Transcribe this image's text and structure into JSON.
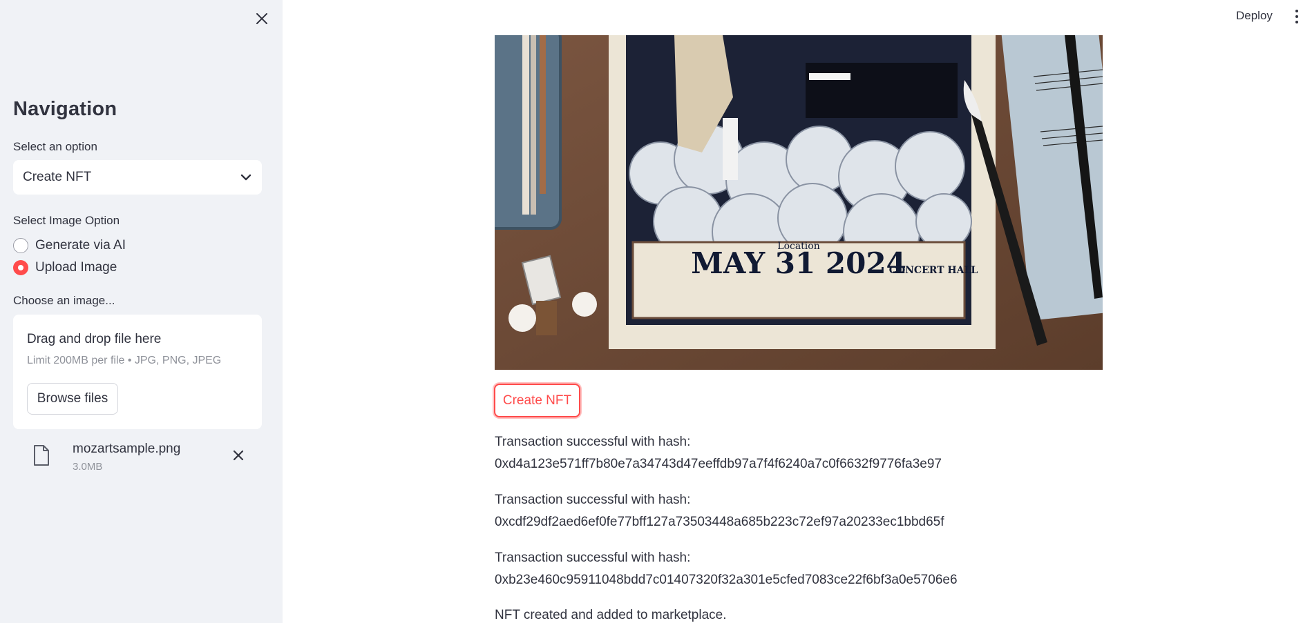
{
  "header": {
    "deploy_label": "Deploy"
  },
  "sidebar": {
    "title": "Navigation",
    "select_label": "Select an option",
    "select_value": "Create NFT",
    "image_option_label": "Select Image Option",
    "radio_options": [
      {
        "label": "Generate via AI",
        "selected": false
      },
      {
        "label": "Upload Image",
        "selected": true
      }
    ],
    "uploader": {
      "label": "Choose an image...",
      "drop_title": "Drag and drop file here",
      "limit_text": "Limit 200MB per file • JPG, PNG, JPEG",
      "browse_label": "Browse files"
    },
    "file": {
      "name": "mozartsample.png",
      "size": "3.0MB"
    }
  },
  "main": {
    "poster": {
      "headline": "MAY 31 2024",
      "location_label": "Location",
      "venue": "CONCERT HALL"
    },
    "create_button_label": "Create NFT",
    "transactions": [
      {
        "label": "Transaction successful with hash:",
        "hash": "0xd4a123e571ff7b80e7a34743d47eeffdb97a7f4f6240a7c0f6632f9776fa3e97"
      },
      {
        "label": "Transaction successful with hash:",
        "hash": "0xcdf29df2aed6ef0fe77bff127a73503448a685b223c72ef97a20233ec1bbd65f"
      },
      {
        "label": "Transaction successful with hash:",
        "hash": "0xb23e460c95911048bdd7c01407320f32a301e5cfed7083ce22f6bf3a0e5706e6"
      }
    ],
    "final_message": "NFT created and added to marketplace."
  },
  "colors": {
    "accent": "#ff4b4b",
    "sidebar_bg": "#f0f2f6",
    "text": "#31333f",
    "muted": "#8f929a"
  },
  "icons": [
    "close-icon",
    "chevron-down-icon",
    "file-icon",
    "remove-file-icon",
    "kebab-menu-icon"
  ]
}
